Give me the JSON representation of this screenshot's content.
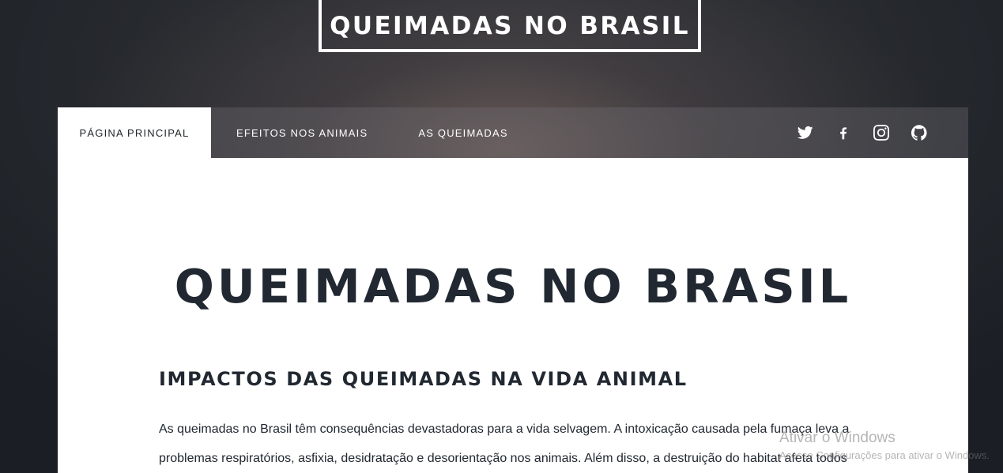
{
  "header": {
    "logo_text": "QUEIMADAS NO BRASIL"
  },
  "nav": {
    "items": [
      {
        "label": "PÁGINA PRINCIPAL",
        "active": true
      },
      {
        "label": "EFEITOS NOS ANIMAIS",
        "active": false
      },
      {
        "label": "AS QUEIMADAS",
        "active": false
      }
    ],
    "social": [
      {
        "icon": "twitter-icon"
      },
      {
        "icon": "facebook-icon"
      },
      {
        "icon": "instagram-icon"
      },
      {
        "icon": "github-icon"
      }
    ]
  },
  "main": {
    "title": "QUEIMADAS NO BRASIL",
    "section_title": "IMPACTOS DAS QUEIMADAS NA VIDA ANIMAL",
    "paragraph": "As queimadas no Brasil têm consequências devastadoras para a vida selvagem. A intoxicação causada pela fumaça leva a problemas respiratórios, asfixia, desidratação e desorientação nos animais. Além disso, a destruição do habitat afeta todos"
  },
  "watermark": {
    "title": "Ativar o Windows",
    "subtitle": "Acesse Configurações para ativar o Windows."
  },
  "colors": {
    "text_dark": "#212831",
    "nav_active_bg": "#ffffff",
    "background_dark": "#1b1f25"
  }
}
